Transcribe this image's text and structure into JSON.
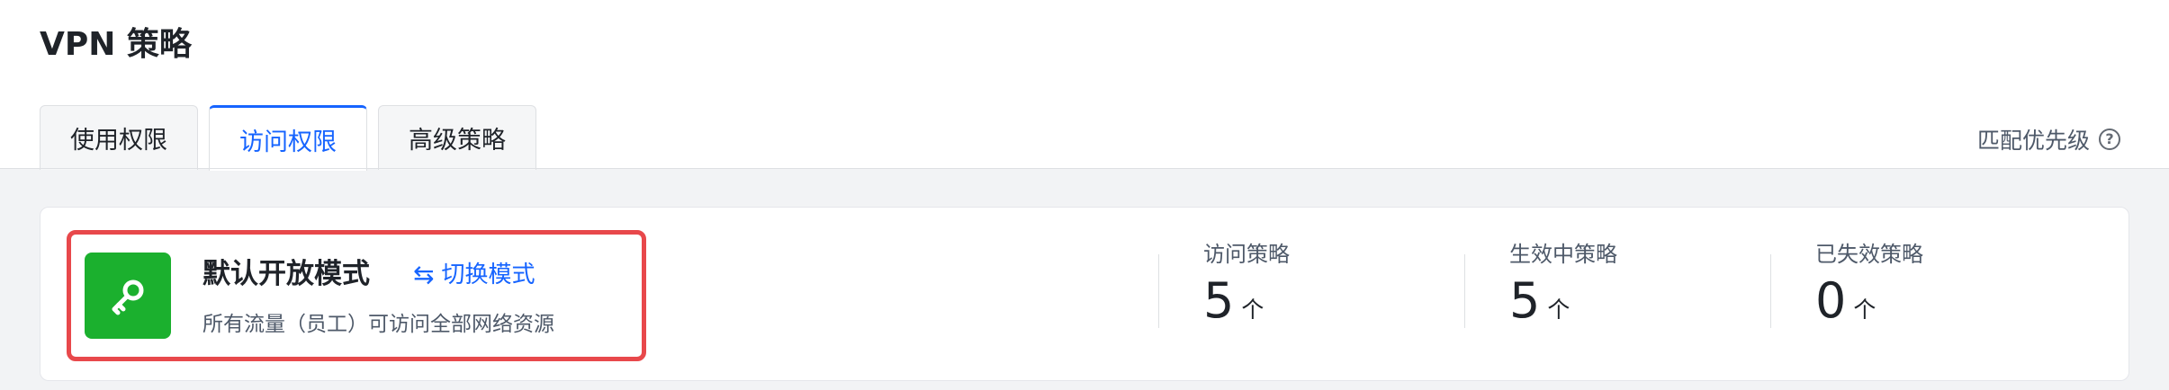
{
  "page": {
    "title": "VPN 策略"
  },
  "tabs": [
    {
      "label": "使用权限",
      "active": false
    },
    {
      "label": "访问权限",
      "active": true
    },
    {
      "label": "高级策略",
      "active": false
    }
  ],
  "match_priority": {
    "label": "匹配优先级",
    "icon": "help-circle-icon"
  },
  "mode": {
    "icon": "key-icon",
    "icon_bg": "#1bb02e",
    "title": "默认开放模式",
    "switch_label": "切换模式",
    "switch_icon": "swap-arrows-icon",
    "description": "所有流量（员工）可访问全部网络资源",
    "highlight_color": "#e8484b"
  },
  "stats": [
    {
      "label": "访问策略",
      "value": "5",
      "unit": "个"
    },
    {
      "label": "生效中策略",
      "value": "5",
      "unit": "个"
    },
    {
      "label": "已失效策略",
      "value": "0",
      "unit": "个"
    }
  ],
  "colors": {
    "accent": "#1664ff",
    "text": "#1f2329",
    "muted": "#4e5969",
    "background": "#f2f3f5"
  }
}
